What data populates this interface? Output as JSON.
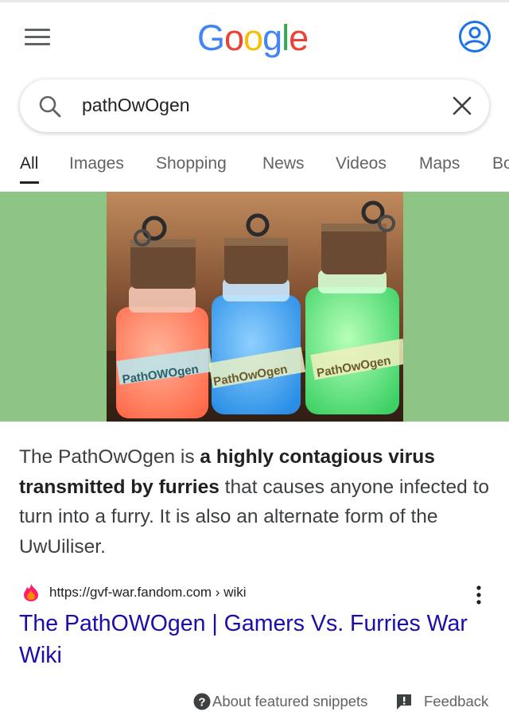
{
  "header": {
    "logo": [
      "G",
      "o",
      "o",
      "g",
      "l",
      "e"
    ],
    "menu_icon": "hamburger-menu-icon",
    "account_icon": "account-circle-icon"
  },
  "search": {
    "query": "pathOwOgen"
  },
  "tabs": [
    {
      "label": "All",
      "active": true
    },
    {
      "label": "Images"
    },
    {
      "label": "Shopping"
    },
    {
      "label": "News"
    },
    {
      "label": "Videos"
    },
    {
      "label": "Maps"
    },
    {
      "label": "Books"
    }
  ],
  "featured_image": {
    "labels": [
      "PathOWOgen",
      "PathOwOgen",
      "PathOwOgen"
    ],
    "bottle_colors": [
      "#ff7a5c",
      "#3fa6ec",
      "#5ee07a"
    ]
  },
  "snippet": {
    "part1": "The PathOwOgen is ",
    "bold1": "a highly contagious virus transmitted by furries",
    "part2": " that causes anyone infected to turn into a furry. It is also an alternate form of the UwUiliser."
  },
  "result": {
    "url": "https://gvf-war.fandom.com › wiki",
    "title": "The PathOWOgen | Gamers Vs. Furries War Wiki"
  },
  "footer": {
    "about": "About featured snippets",
    "feedback": "Feedback"
  },
  "colors": {
    "link": "#1a0dab",
    "hero_bg": "#8fc584"
  }
}
